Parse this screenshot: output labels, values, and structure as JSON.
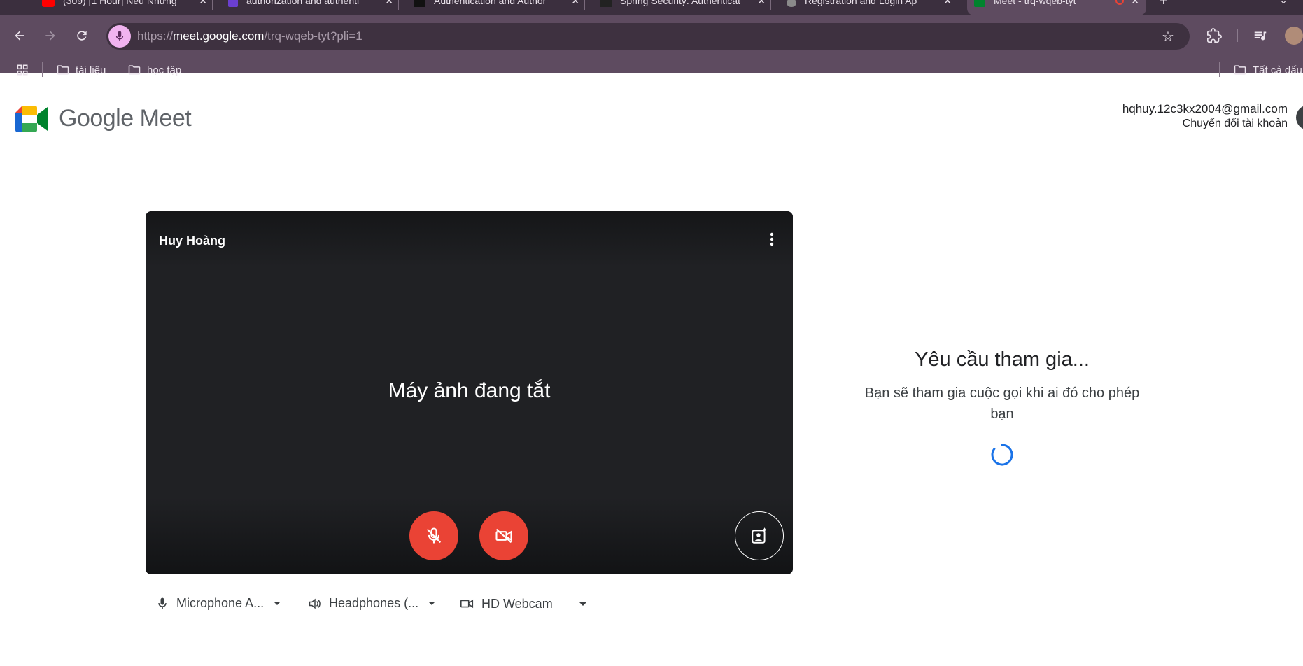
{
  "browser": {
    "tabs": [
      {
        "title": "(309) [1 Hour] Nếu Những",
        "favicon_color": "#ff0000"
      },
      {
        "title": "authorization and authenti",
        "favicon_color": "#6b3fd0"
      },
      {
        "title": "Authentication and Author",
        "favicon_color": "#111111"
      },
      {
        "title": "Spring Security: Authenticat",
        "favicon_color": "#222222"
      },
      {
        "title": "Registration and Login Ap",
        "favicon_color": "#8a8a8a"
      },
      {
        "title": "Meet - trq-wqeb-tyt",
        "favicon_color": "#00832d",
        "active": true
      }
    ],
    "address_bar": {
      "scheme": "https://",
      "host": "meet.google.com",
      "path": "/trq-wqeb-tyt?pli=1"
    },
    "bookmarks": [
      {
        "label": "tài liệu",
        "icon": "folder-icon"
      },
      {
        "label": "học tập",
        "icon": "folder-icon"
      }
    ],
    "all_bookmarks_label": "Tất cả dấu"
  },
  "meet": {
    "logo_text": "Google Meet",
    "account": {
      "email": "hqhuy.12c3kx2004@gmail.com",
      "switch_label": "Chuyển đổi tài khoản"
    },
    "preview": {
      "user_name": "Huy Hoàng",
      "camera_off_text": "Máy ảnh đang tắt"
    },
    "devices": {
      "microphone": "Microphone A...",
      "speaker": "Headphones (...",
      "camera": "HD Webcam"
    },
    "join": {
      "title": "Yêu cầu tham gia...",
      "subtitle": "Bạn sẽ tham gia cuộc gọi khi ai đó cho phép bạn"
    }
  },
  "colors": {
    "accent_red": "#ea4335",
    "spinner_blue": "#1a73e8",
    "chrome_frame": "#5e4b60"
  }
}
